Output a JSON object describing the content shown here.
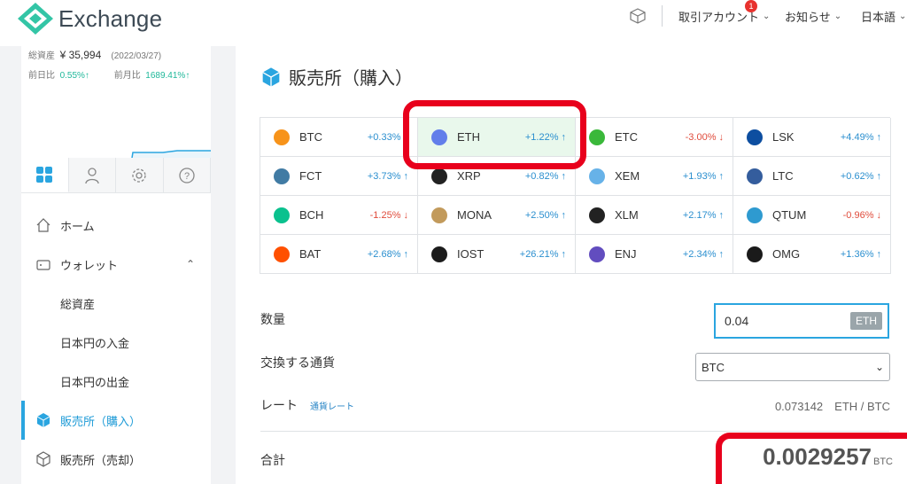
{
  "header": {
    "brand": "Exchange",
    "account_label": "取引アカウント",
    "account_badge": "1",
    "news_label": "お知らせ",
    "language_label": "日本語",
    "accent_color": "#33c5a6"
  },
  "sidebar": {
    "total_label": "総資産",
    "total_value": "¥ 35,994",
    "total_date": "(2022/03/27)",
    "day_label": "前日比",
    "day_value": "0.55%",
    "month_label": "前月比",
    "month_value": "1689.41%",
    "tabs": [
      "dashboard-icon",
      "user-icon",
      "gear-icon",
      "help-icon"
    ],
    "nav": {
      "home": "ホーム",
      "wallet": "ウォレット",
      "assets": "総資産",
      "deposit": "日本円の入金",
      "withdraw": "日本円の出金",
      "buy": "販売所（購入）",
      "sell": "販売所（売却）"
    }
  },
  "main": {
    "title": "販売所（購入）",
    "coins": [
      {
        "symbol": "BTC",
        "change": "+0.33%",
        "dir": "up",
        "icon": "btc-icon"
      },
      {
        "symbol": "ETH",
        "change": "+1.22%",
        "dir": "up",
        "icon": "eth-icon",
        "selected": true
      },
      {
        "symbol": "ETC",
        "change": "-3.00%",
        "dir": "down",
        "icon": "etc-icon"
      },
      {
        "symbol": "LSK",
        "change": "+4.49%",
        "dir": "up",
        "icon": "lsk-icon"
      },
      {
        "symbol": "FCT",
        "change": "+3.73%",
        "dir": "up",
        "icon": "fct-icon"
      },
      {
        "symbol": "XRP",
        "change": "+0.82%",
        "dir": "up",
        "icon": "xrp-icon"
      },
      {
        "symbol": "XEM",
        "change": "+1.93%",
        "dir": "up",
        "icon": "xem-icon"
      },
      {
        "symbol": "LTC",
        "change": "+0.62%",
        "dir": "up",
        "icon": "ltc-icon"
      },
      {
        "symbol": "BCH",
        "change": "-1.25%",
        "dir": "down",
        "icon": "bch-icon"
      },
      {
        "symbol": "MONA",
        "change": "+2.50%",
        "dir": "up",
        "icon": "mona-icon"
      },
      {
        "symbol": "XLM",
        "change": "+2.17%",
        "dir": "up",
        "icon": "xlm-icon"
      },
      {
        "symbol": "QTUM",
        "change": "-0.96%",
        "dir": "down",
        "icon": "qtum-icon"
      },
      {
        "symbol": "BAT",
        "change": "+2.68%",
        "dir": "up",
        "icon": "bat-icon"
      },
      {
        "symbol": "IOST",
        "change": "+26.21%",
        "dir": "up",
        "icon": "iost-icon"
      },
      {
        "symbol": "ENJ",
        "change": "+2.34%",
        "dir": "up",
        "icon": "enj-icon"
      },
      {
        "symbol": "OMG",
        "change": "+1.36%",
        "dir": "up",
        "icon": "omg-icon"
      }
    ],
    "quantity_label": "数量",
    "quantity_value": "0.04",
    "quantity_unit": "ETH",
    "currency_label": "交換する通貨",
    "currency_value": "BTC",
    "rate_label": "レート",
    "rate_link": "通貨レート",
    "rate_value": "0.073142　ETH / BTC",
    "total_label": "合計",
    "total_value": "0.0029257",
    "total_unit": "BTC"
  }
}
